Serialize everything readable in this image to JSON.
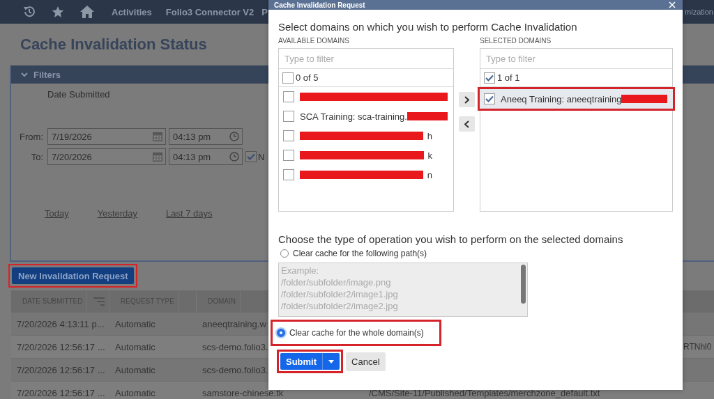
{
  "nav": {
    "links": [
      "Activities",
      "Folio3 Connector V2",
      "P"
    ],
    "right_text": "mization"
  },
  "page_title": "Cache Invalidation Status",
  "filters": {
    "title": "Filters",
    "expanded": true,
    "date_label": "Date Submitted",
    "from": {
      "label": "From:",
      "date": "7/19/2026",
      "time": "04:13 pm"
    },
    "to": {
      "label": "To:",
      "date": "7/20/2026",
      "time": "04:13 pm",
      "checked": true,
      "checkbox_label": "N"
    },
    "quick_ranges": [
      "Today",
      "Yesterday",
      "Last 7 days"
    ]
  },
  "new_request_button": {
    "label": "New Invalidation Request",
    "highlighted": true
  },
  "table": {
    "columns": [
      "DATE SUBMITTED",
      "REQUEST TYPE",
      "DOMAIN"
    ],
    "rows": [
      {
        "date": "7/20/2026 4:13:11 p...",
        "type": "Automatic",
        "domain": "aneeqtraining.w"
      },
      {
        "date": "7/20/2026 12:56:17 ...",
        "type": "Automatic",
        "domain": "scs-demo.folio3.",
        "column_5": "RTNhl0"
      },
      {
        "date": "7/20/2026 12:56:17 ...",
        "type": "Automatic",
        "domain": "scs-demo.folio3."
      },
      {
        "date": "7/20/2026 12:56:17 ...",
        "type": "Automatic",
        "domain": "samstore-chinese.tk",
        "column_4": "/CMS/Site-11/Published/Templates/merchzone_default.txt"
      }
    ]
  },
  "dialog": {
    "title": "Cache Invalidation Request",
    "heading": "Select domains on which you wish to perform Cache Invalidation",
    "available": {
      "label": "AVAILABLE DOMAINS",
      "filter_placeholder": "Type to filter",
      "count": "0 of 5",
      "all_checked": false,
      "items": [
        {
          "checked": false,
          "redacted": true
        },
        {
          "checked": false,
          "label": "SCA Training: sca-training.",
          "redacted": true
        },
        {
          "checked": false,
          "redacted": true,
          "tail": "h"
        },
        {
          "checked": false,
          "redacted": true,
          "tail": "k"
        },
        {
          "checked": false,
          "redacted": true,
          "tail": "n"
        }
      ]
    },
    "selected": {
      "label": "SELECTED DOMAINS",
      "filter_placeholder": "Type to filter",
      "count": "1 of 1",
      "all_checked": true,
      "items": [
        {
          "checked": true,
          "label": "Aneeq Training: aneeqtraining",
          "redacted": true,
          "highlighted": true
        }
      ]
    },
    "operation_heading": "Choose the type of operation you wish to perform on the selected domains",
    "options": [
      {
        "label": "Clear cache for the following path(s)",
        "selected": false,
        "highlighted": false
      },
      {
        "label": "Clear cache for the whole domain(s)",
        "selected": true,
        "highlighted": true
      }
    ],
    "paths": {
      "placeholder": "Example:\n/folder/subfolder/image.png\n/folder/subfolder2/image1.jpg\n/folder/subfolder2/image2.jpg",
      "disabled": true
    },
    "submit": {
      "label": "Submit",
      "highlighted": true
    },
    "cancel": "Cancel"
  }
}
